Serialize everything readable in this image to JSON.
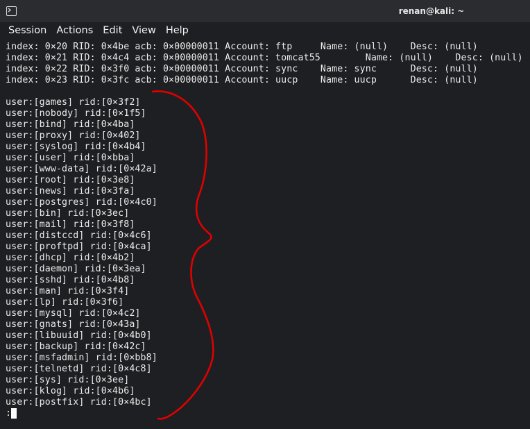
{
  "window": {
    "title": "renan@kali: ~",
    "icon": "terminal-icon"
  },
  "menu": [
    "Session",
    "Actions",
    "Edit",
    "View",
    "Help"
  ],
  "terminal": {
    "enum_lines": [
      "index: 0×20 RID: 0×4be acb: 0×00000011 Account: ftp     Name: (null)    Desc: (null)",
      "index: 0×21 RID: 0×4c4 acb: 0×00000011 Account: tomcat55        Name: (null)    Desc: (null)",
      "index: 0×22 RID: 0×3f0 acb: 0×00000011 Account: sync    Name: sync      Desc: (null)",
      "index: 0×23 RID: 0×3fc acb: 0×00000011 Account: uucp    Name: uucp      Desc: (null)"
    ],
    "user_lines": [
      "user:[games] rid:[0×3f2]",
      "user:[nobody] rid:[0×1f5]",
      "user:[bind] rid:[0×4ba]",
      "user:[proxy] rid:[0×402]",
      "user:[syslog] rid:[0×4b4]",
      "user:[user] rid:[0×bba]",
      "user:[www-data] rid:[0×42a]",
      "user:[root] rid:[0×3e8]",
      "user:[news] rid:[0×3fa]",
      "user:[postgres] rid:[0×4c0]",
      "user:[bin] rid:[0×3ec]",
      "user:[mail] rid:[0×3f8]",
      "user:[distccd] rid:[0×4c6]",
      "user:[proftpd] rid:[0×4ca]",
      "user:[dhcp] rid:[0×4b2]",
      "user:[daemon] rid:[0×3ea]",
      "user:[sshd] rid:[0×4b8]",
      "user:[man] rid:[0×3f4]",
      "user:[lp] rid:[0×3f6]",
      "user:[mysql] rid:[0×4c2]",
      "user:[gnats] rid:[0×43a]",
      "user:[libuuid] rid:[0×4b0]",
      "user:[backup] rid:[0×42c]",
      "user:[msfadmin] rid:[0×bb8]",
      "user:[telnetd] rid:[0×4c8]",
      "user:[sys] rid:[0×3ee]",
      "user:[klog] rid:[0×4b6]",
      "user:[postfix] rid:[0×4bc]"
    ],
    "prompt": ":"
  },
  "annotation_color": "#e00000",
  "colors": {
    "background": "#1e1f22",
    "titlebar": "#2b2c30",
    "text": "#ebebeb"
  }
}
